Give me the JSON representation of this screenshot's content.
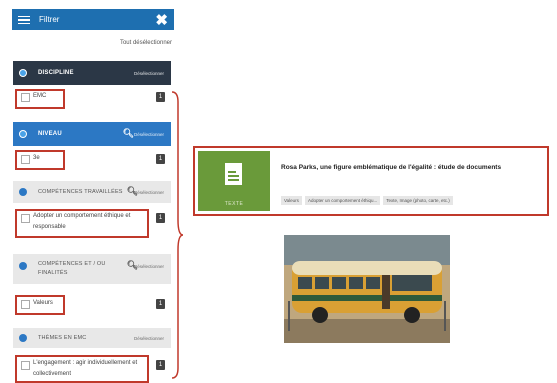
{
  "filter": {
    "title": "Filtrer",
    "deselect_all": "Tout désélectionner"
  },
  "sections": [
    {
      "title": "DISCIPLINE",
      "unselect": "Désélectionner",
      "option": {
        "label": "EMC",
        "count": "1"
      }
    },
    {
      "title": "NIVEAU",
      "unselect": "Désélectionner",
      "option": {
        "label": "3e",
        "count": "1"
      }
    },
    {
      "title": "COMPÉTENCES TRAVAILLÉES",
      "unselect": "Désélectionner",
      "option": {
        "label": "Adopter un comportement éthique et responsable",
        "count": "1"
      }
    },
    {
      "title": "COMPÉTENCES ET / OU FINALITÉS",
      "unselect": "Désélectionner",
      "option": {
        "label": "Valeurs",
        "count": "1"
      }
    },
    {
      "title": "THÈMES EN EMC",
      "unselect": "Désélectionner",
      "option": {
        "label": "L'engagement : agir individuellement et collectivement",
        "count": "1"
      }
    }
  ],
  "result": {
    "type_label": "TEXTE",
    "title": "Rosa Parks, une figure emblématique de l'égalité : étude de documents",
    "tags": [
      "Valeurs",
      "Adopter un comportement éthiqu...",
      "Texte, Image (photo, carte, etc.)"
    ]
  },
  "colors": {
    "accent": "#1e6fb0",
    "highlight": "#c0392b",
    "thumb": "#6a9a3a"
  }
}
